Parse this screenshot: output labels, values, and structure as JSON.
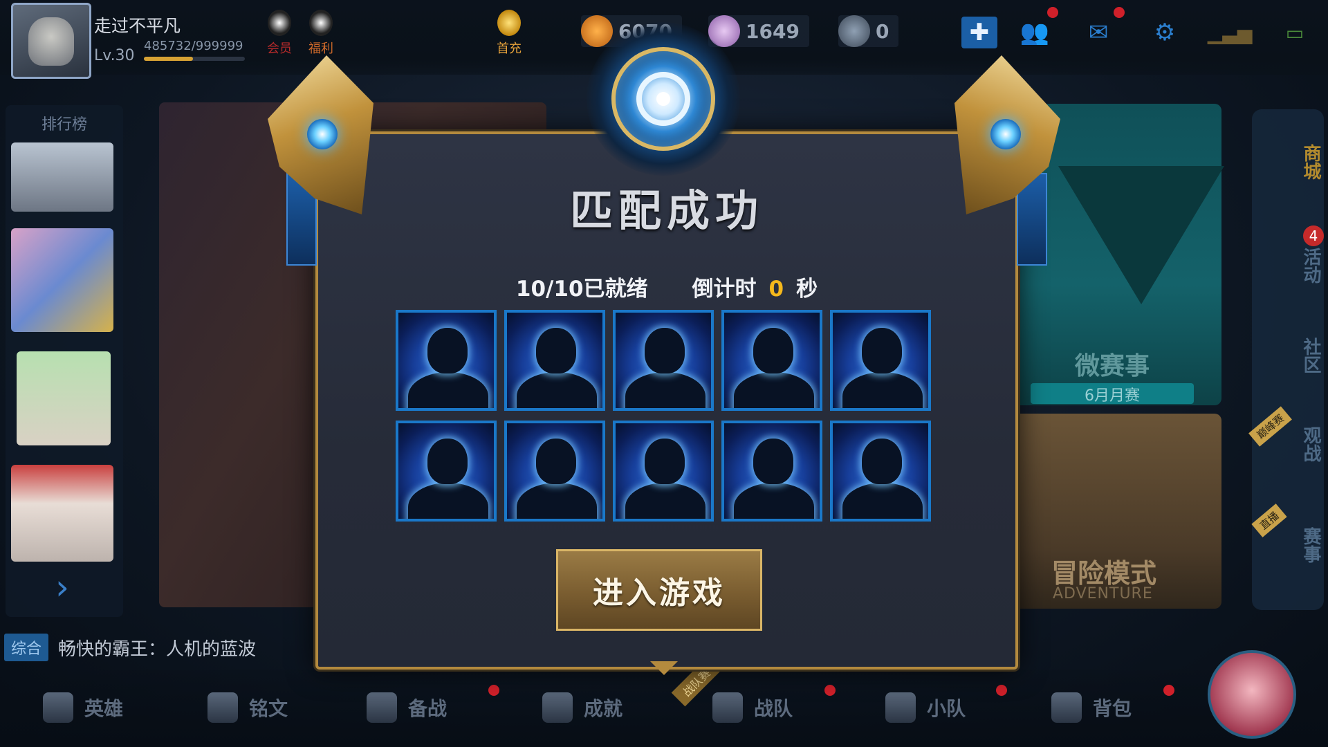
{
  "profile": {
    "username": "走过不平凡",
    "level": "Lv.30",
    "exp_text": "485732/999999",
    "exp_progress": 0.486
  },
  "top_shortcuts": [
    {
      "label": "会员",
      "icon": "penguin-member-icon"
    },
    {
      "label": "福利",
      "icon": "penguin-gift-icon"
    },
    {
      "label": "首充",
      "icon": "money-bag-icon"
    }
  ],
  "currencies": [
    {
      "icon": "gold-coin-icon",
      "value": "6070"
    },
    {
      "icon": "diamond-icon",
      "value": "1649"
    },
    {
      "icon": "voucher-icon",
      "value": "0"
    }
  ],
  "top_icons": [
    "add-icon",
    "friends-icon",
    "mail-icon",
    "settings-icon",
    "signal-icon",
    "battery-icon"
  ],
  "left_panel": {
    "title": "排行榜"
  },
  "chat": {
    "channel": "综合",
    "message": "畅快的霸王：人机的蓝波"
  },
  "bottom_nav": [
    {
      "label": "英雄",
      "icon": "hero-helmet-icon"
    },
    {
      "label": "铭文",
      "icon": "rune-icon"
    },
    {
      "label": "备战",
      "icon": "sword-icon"
    },
    {
      "label": "成就",
      "icon": "achievement-icon"
    },
    {
      "label": "战队",
      "icon": "dragon-icon"
    },
    {
      "label": "小队",
      "icon": "squad-icon"
    },
    {
      "label": "背包",
      "icon": "backpack-icon"
    }
  ],
  "bottom_ribbon": "战队赛",
  "right_cards": {
    "event_title": "微赛事",
    "event_sub": "6月月赛",
    "adventure_title": "冒险模式",
    "adventure_sub": "ADVENTURE"
  },
  "right_bar": {
    "items": [
      "商城",
      "活动",
      "社区",
      "观战",
      "赛事"
    ],
    "activity_badge": "4",
    "ribbon_watch": "巅峰赛",
    "ribbon_match": "直播"
  },
  "modal": {
    "title": "匹配成功",
    "ready": "10/10已就绪",
    "countdown_label": "倒计时",
    "countdown_value": "0",
    "countdown_unit": "秒",
    "player_count": 10,
    "enter_button": "进入游戏"
  },
  "colors": {
    "accent_gold": "#b38a3e",
    "countdown": "#f4b81c",
    "player_border": "#1a78c9"
  }
}
